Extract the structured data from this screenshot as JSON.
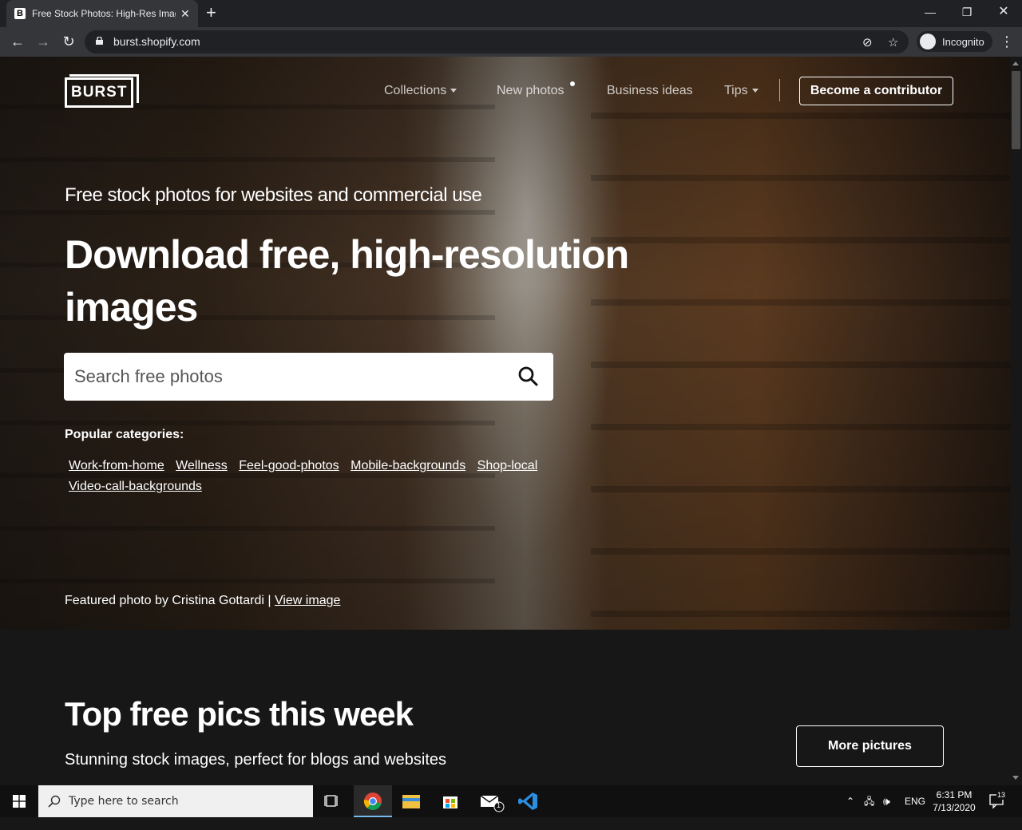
{
  "browser": {
    "tab_title": "Free Stock Photos: High-Res Images",
    "favicon_letter": "B",
    "url": "burst.shopify.com",
    "incognito_label": "Incognito"
  },
  "site": {
    "logo_text": "BURST",
    "nav": {
      "collections": "Collections",
      "new_photos": "New photos",
      "business_ideas": "Business ideas",
      "tips": "Tips",
      "contribute": "Become a contributor"
    },
    "hero": {
      "subtitle": "Free stock photos for websites and commercial use",
      "title": "Download free, high-resolution images",
      "search_placeholder": "Search free photos",
      "popular_label": "Popular categories:",
      "categories": [
        "Work-from-home",
        "Wellness",
        "Feel-good-photos",
        "Mobile-backgrounds",
        "Shop-local",
        "Video-call-backgrounds"
      ],
      "credit_prefix": "Featured photo by Cristina Gottardi |",
      "credit_link": "View image"
    },
    "section": {
      "title": "Top free pics this week",
      "subtitle": "Stunning stock images, perfect for blogs and websites",
      "more_button": "More pictures"
    }
  },
  "taskbar": {
    "search_placeholder": "Type here to search",
    "language": "ENG",
    "time": "6:31 PM",
    "date": "7/13/2020",
    "notification_count": "13",
    "mail_badge": "1"
  }
}
